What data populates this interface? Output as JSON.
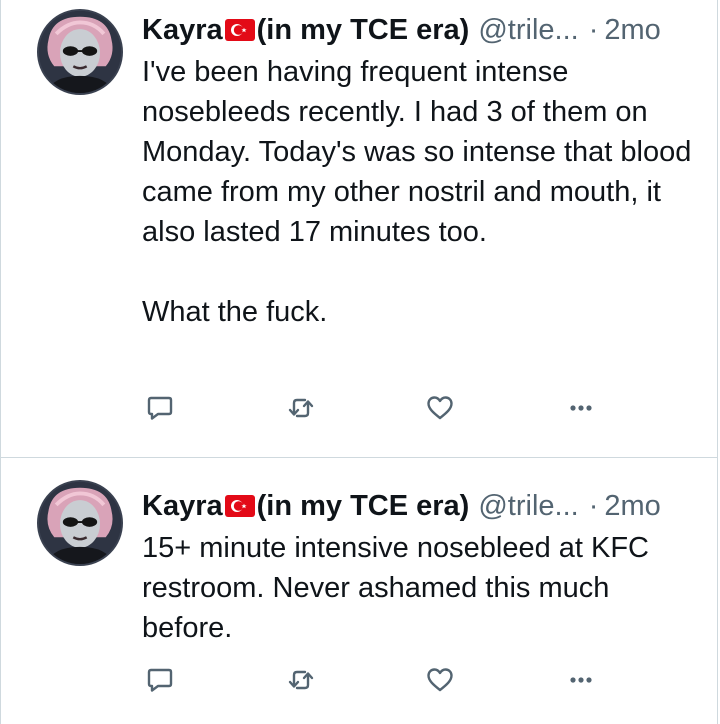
{
  "colors": {
    "text_primary": "#0f1419",
    "text_secondary": "#536471",
    "border": "#cfd9de",
    "flag_red": "#e30a17"
  },
  "tweets": [
    {
      "avatar_icon": "profile-avatar",
      "display_name_prefix": "Kayra",
      "flag_icon": "turkey-flag-icon",
      "display_name_suffix": "(in my TCE era)",
      "handle": "@trile...",
      "separator": "·",
      "time": "2mo",
      "paragraphs": [
        "I've been having frequent intense nosebleeds recently. I had 3 of them on Monday. Today's was so intense that blood came from my other nostril and mouth, it also lasted 17 minutes too.",
        "What the fuck."
      ],
      "actions": [
        "reply-icon",
        "retweet-icon",
        "like-icon",
        "more-icon"
      ]
    },
    {
      "avatar_icon": "profile-avatar",
      "display_name_prefix": "Kayra",
      "flag_icon": "turkey-flag-icon",
      "display_name_suffix": "(in my TCE era)",
      "handle": "@trile...",
      "separator": "·",
      "time": "2mo",
      "paragraphs": [
        "15+ minute intensive nosebleed at KFC restroom. Never ashamed this much before."
      ],
      "actions": [
        "reply-icon",
        "retweet-icon",
        "like-icon",
        "more-icon"
      ]
    }
  ]
}
